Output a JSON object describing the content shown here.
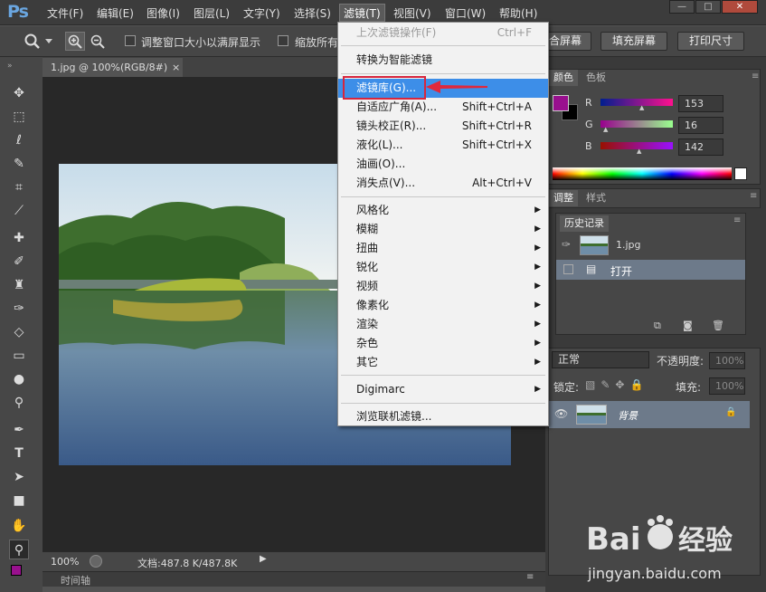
{
  "app": {
    "logo": "Ps"
  },
  "menubar": {
    "items": [
      "文件(F)",
      "编辑(E)",
      "图像(I)",
      "图层(L)",
      "文字(Y)",
      "选择(S)",
      "滤镜(T)",
      "视图(V)",
      "窗口(W)",
      "帮助(H)"
    ],
    "active": "滤镜(T)"
  },
  "window_controls": {
    "minimize": "—",
    "restore": "□",
    "close": "✕"
  },
  "optionsbar": {
    "checkbox1_label": "调整窗口大小以满屏显示",
    "checkbox2_label": "缩放所有",
    "btn_fit": "合屏幕",
    "btn_fill": "填充屏幕",
    "btn_print": "打印尺寸"
  },
  "document": {
    "tab_title": "1.jpg @ 100%(RGB/8#)",
    "tab_close": "×",
    "zoom": "100%",
    "doc_info": "文档:487.8 K/487.8K",
    "timeline_label": "时间轴"
  },
  "filter_menu": {
    "items": [
      {
        "label": "上次滤镜操作(F)",
        "shortcut": "Ctrl+F",
        "disabled": true
      },
      {
        "label": "转换为智能滤镜"
      },
      {
        "label": "滤镜库(G)...",
        "highlighted": true
      },
      {
        "label": "自适应广角(A)...",
        "shortcut": "Shift+Ctrl+A"
      },
      {
        "label": "镜头校正(R)...",
        "shortcut": "Shift+Ctrl+R"
      },
      {
        "label": "液化(L)...",
        "shortcut": "Shift+Ctrl+X"
      },
      {
        "label": "油画(O)..."
      },
      {
        "label": "消失点(V)...",
        "shortcut": "Alt+Ctrl+V"
      },
      {
        "label": "风格化",
        "submenu": true
      },
      {
        "label": "模糊",
        "submenu": true
      },
      {
        "label": "扭曲",
        "submenu": true
      },
      {
        "label": "锐化",
        "submenu": true
      },
      {
        "label": "视频",
        "submenu": true
      },
      {
        "label": "像素化",
        "submenu": true
      },
      {
        "label": "渲染",
        "submenu": true
      },
      {
        "label": "杂色",
        "submenu": true
      },
      {
        "label": "其它",
        "submenu": true
      },
      {
        "label": "Digimarc",
        "submenu": true
      },
      {
        "label": "浏览联机滤镜..."
      }
    ]
  },
  "color_panel": {
    "tab_color": "颜色",
    "tab_swatches": "色板",
    "r_label": "R",
    "g_label": "G",
    "b_label": "B",
    "r": "153",
    "g": "16",
    "b": "142",
    "fg_color": "#99108e"
  },
  "adjust_panel": {
    "tab_adjust": "调整",
    "tab_styles": "样式"
  },
  "history_panel": {
    "tab": "历史记录",
    "snapshot": "1.jpg",
    "step": "打开"
  },
  "layers_panel": {
    "blend_mode": "正常",
    "opacity_label": "不透明度:",
    "opacity": "100%",
    "lock_label": "锁定:",
    "fill_label": "填充:",
    "fill": "100%",
    "layer_name": "背景"
  },
  "watermark": {
    "brand": "Bai",
    "brand2": "经验",
    "url": "jingyan.baidu.com"
  }
}
